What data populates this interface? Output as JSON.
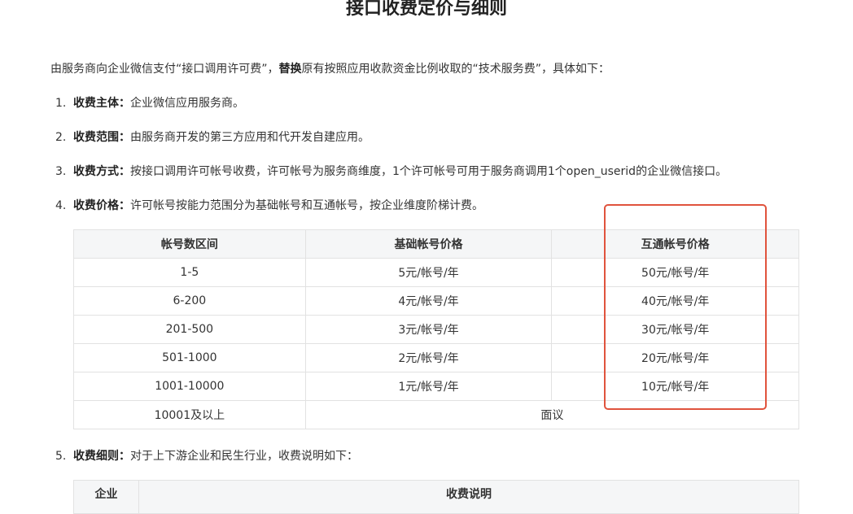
{
  "title": "接口收费定价与细则",
  "intro": {
    "part1": "由服务商向企业微信支付“接口调用许可费”，",
    "bold": "替换",
    "part2": "原有按照应用收款资金比例收取的“技术服务费”，具体如下："
  },
  "items": [
    {
      "num": "1.",
      "label": "收费主体：",
      "text": "企业微信应用服务商。"
    },
    {
      "num": "2.",
      "label": "收费范围：",
      "text": "由服务商开发的第三方应用和代开发自建应用。"
    },
    {
      "num": "3.",
      "label": "收费方式：",
      "text": "按接口调用许可帐号收费，许可帐号为服务商维度，1个许可帐号可用于服务商调用1个open_userid的企业微信接口。"
    },
    {
      "num": "4.",
      "label": "收费价格：",
      "text": "许可帐号按能力范围分为基础帐号和互通帐号，按企业维度阶梯计费。"
    },
    {
      "num": "5.",
      "label": "收费细则：",
      "text": "对于上下游企业和民生行业，收费说明如下："
    }
  ],
  "price_table": {
    "headers": [
      "帐号数区间",
      "基础帐号价格",
      "互通帐号价格"
    ],
    "rows": [
      [
        "1-5",
        "5元/帐号/年",
        "50元/帐号/年"
      ],
      [
        "6-200",
        "4元/帐号/年",
        "40元/帐号/年"
      ],
      [
        "201-500",
        "3元/帐号/年",
        "30元/帐号/年"
      ],
      [
        "501-1000",
        "2元/帐号/年",
        "20元/帐号/年"
      ],
      [
        "1001-10000",
        "1元/帐号/年",
        "10元/帐号/年"
      ]
    ],
    "last_row": {
      "range": "10001及以上",
      "price": "面议"
    }
  },
  "detail_table": {
    "headers": [
      "企业",
      "收费说明"
    ]
  },
  "colors": {
    "highlight": "#e0533d",
    "header_bg": "#f5f6f7",
    "border": "#e2e2e2"
  }
}
